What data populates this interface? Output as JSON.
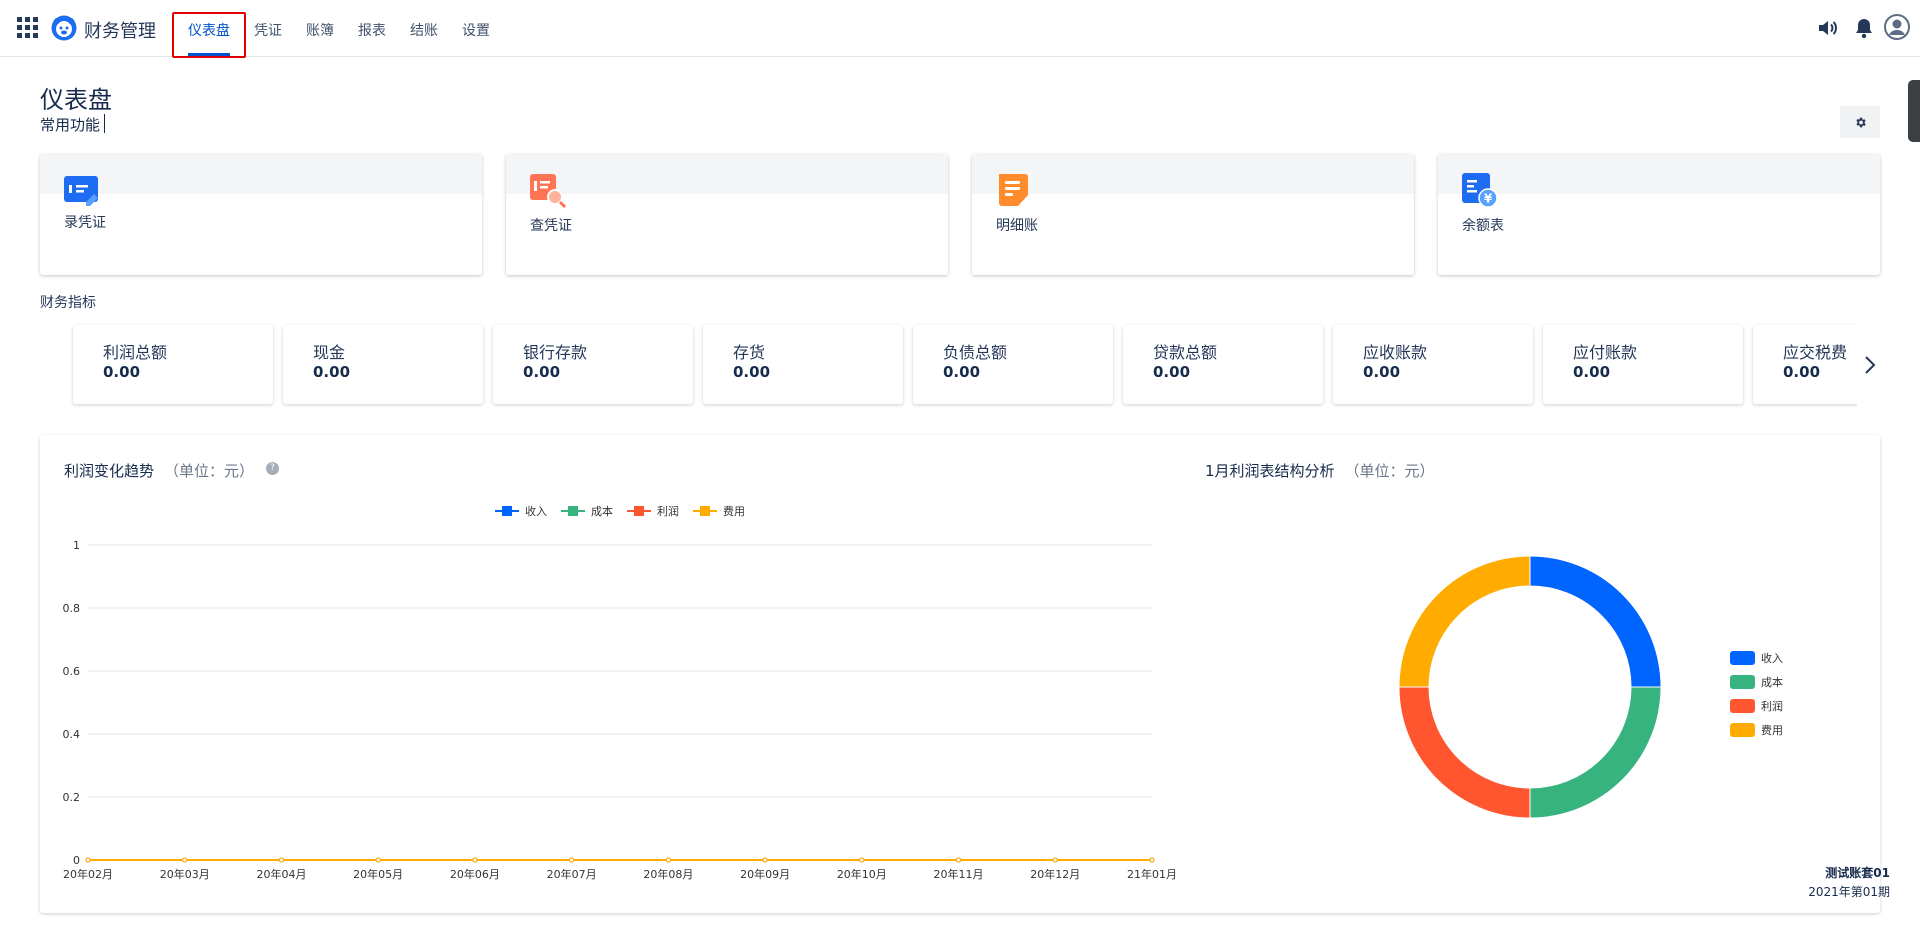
{
  "app": {
    "title": "财务管理"
  },
  "nav": {
    "tabs": [
      {
        "label": "仪表盘",
        "active": true
      },
      {
        "label": "凭证",
        "active": false
      },
      {
        "label": "账簿",
        "active": false
      },
      {
        "label": "报表",
        "active": false
      },
      {
        "label": "结账",
        "active": false
      },
      {
        "label": "设置",
        "active": false
      }
    ],
    "right_icons": [
      "speaker-icon",
      "bell-icon",
      "user-avatar-icon"
    ]
  },
  "page": {
    "title": "仪表盘",
    "common_functions_label": "常用功能"
  },
  "quick_functions": [
    {
      "label": "录凭证",
      "icon": "record-voucher-icon",
      "color": "#1e6cf2"
    },
    {
      "label": "查凭证",
      "icon": "query-voucher-icon",
      "color": "#ff7452"
    },
    {
      "label": "明细账",
      "icon": "detail-ledger-icon",
      "color": "#ff8b2c"
    },
    {
      "label": "余额表",
      "icon": "balance-sheet-icon",
      "color": "#1e6cf2"
    }
  ],
  "indicators": {
    "label": "财务指标",
    "items": [
      {
        "name": "利润总额",
        "value": "0.00"
      },
      {
        "name": "现金",
        "value": "0.00"
      },
      {
        "name": "银行存款",
        "value": "0.00"
      },
      {
        "name": "存货",
        "value": "0.00"
      },
      {
        "name": "负债总额",
        "value": "0.00"
      },
      {
        "name": "贷款总额",
        "value": "0.00"
      },
      {
        "name": "应收账款",
        "value": "0.00"
      },
      {
        "name": "应付账款",
        "value": "0.00"
      },
      {
        "name": "应交税费",
        "value": "0.00"
      }
    ]
  },
  "colors": {
    "accent": "#0052cc",
    "income": "#0065ff",
    "cost": "#36b37e",
    "profit": "#ff5630",
    "expense": "#ffab00"
  },
  "chart_data": [
    {
      "type": "line",
      "title": "利润变化趋势",
      "unit": "（单位：元）",
      "x": [
        "20年02月",
        "20年03月",
        "20年04月",
        "20年05月",
        "20年06月",
        "20年07月",
        "20年08月",
        "20年09月",
        "20年10月",
        "20年11月",
        "20年12月",
        "21年01月"
      ],
      "yticks": [
        "0",
        "0.2",
        "0.4",
        "0.6",
        "0.8",
        "1"
      ],
      "ylim": [
        0,
        1
      ],
      "grid": true,
      "legend_position": "top-center",
      "series": [
        {
          "name": "收入",
          "color": "#0065ff",
          "values": [
            0,
            0,
            0,
            0,
            0,
            0,
            0,
            0,
            0,
            0,
            0,
            0
          ]
        },
        {
          "name": "成本",
          "color": "#36b37e",
          "values": [
            0,
            0,
            0,
            0,
            0,
            0,
            0,
            0,
            0,
            0,
            0,
            0
          ]
        },
        {
          "name": "利润",
          "color": "#ff5630",
          "values": [
            0,
            0,
            0,
            0,
            0,
            0,
            0,
            0,
            0,
            0,
            0,
            0
          ]
        },
        {
          "name": "费用",
          "color": "#ffab00",
          "values": [
            0,
            0,
            0,
            0,
            0,
            0,
            0,
            0,
            0,
            0,
            0,
            0
          ]
        }
      ]
    },
    {
      "type": "pie",
      "title": "1月利润表结构分析",
      "unit": "（单位：元）",
      "legend_position": "right",
      "slices": [
        {
          "name": "收入",
          "color": "#0065ff",
          "value": 1
        },
        {
          "name": "成本",
          "color": "#36b37e",
          "value": 1
        },
        {
          "name": "利润",
          "color": "#ff5630",
          "value": 1
        },
        {
          "name": "费用",
          "color": "#ffab00",
          "value": 1
        }
      ]
    }
  ],
  "footer": {
    "account_set": "测试账套01",
    "period": "2021年第01期"
  }
}
